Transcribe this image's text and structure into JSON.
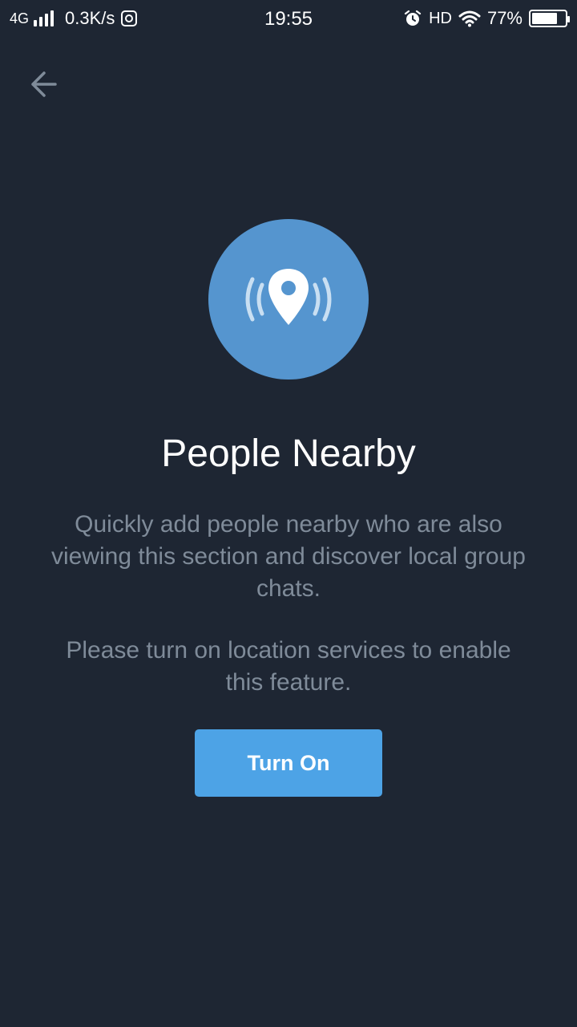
{
  "status_bar": {
    "network": "4G",
    "speed": "0.3K/s",
    "time": "19:55",
    "hd": "HD",
    "battery": "77%",
    "battery_level": 0.77,
    "icons": [
      "signal-icon",
      "app-notification-icon",
      "alarm-icon",
      "wifi-icon",
      "battery-icon"
    ]
  },
  "nav": {
    "back_icon": "arrow-left-icon"
  },
  "hero": {
    "icon": "location-pin-broadcast-icon",
    "circle_color": "#5595cf"
  },
  "content": {
    "title": "People Nearby",
    "description": "Quickly add people nearby who are also viewing this section and discover local group chats.",
    "location_note": "Please turn on location services to enable this feature."
  },
  "actions": {
    "turn_on_label": "Turn On",
    "button_color": "#4da3e6"
  },
  "theme": {
    "background": "#1e2633",
    "text_secondary": "#7f8b99"
  }
}
